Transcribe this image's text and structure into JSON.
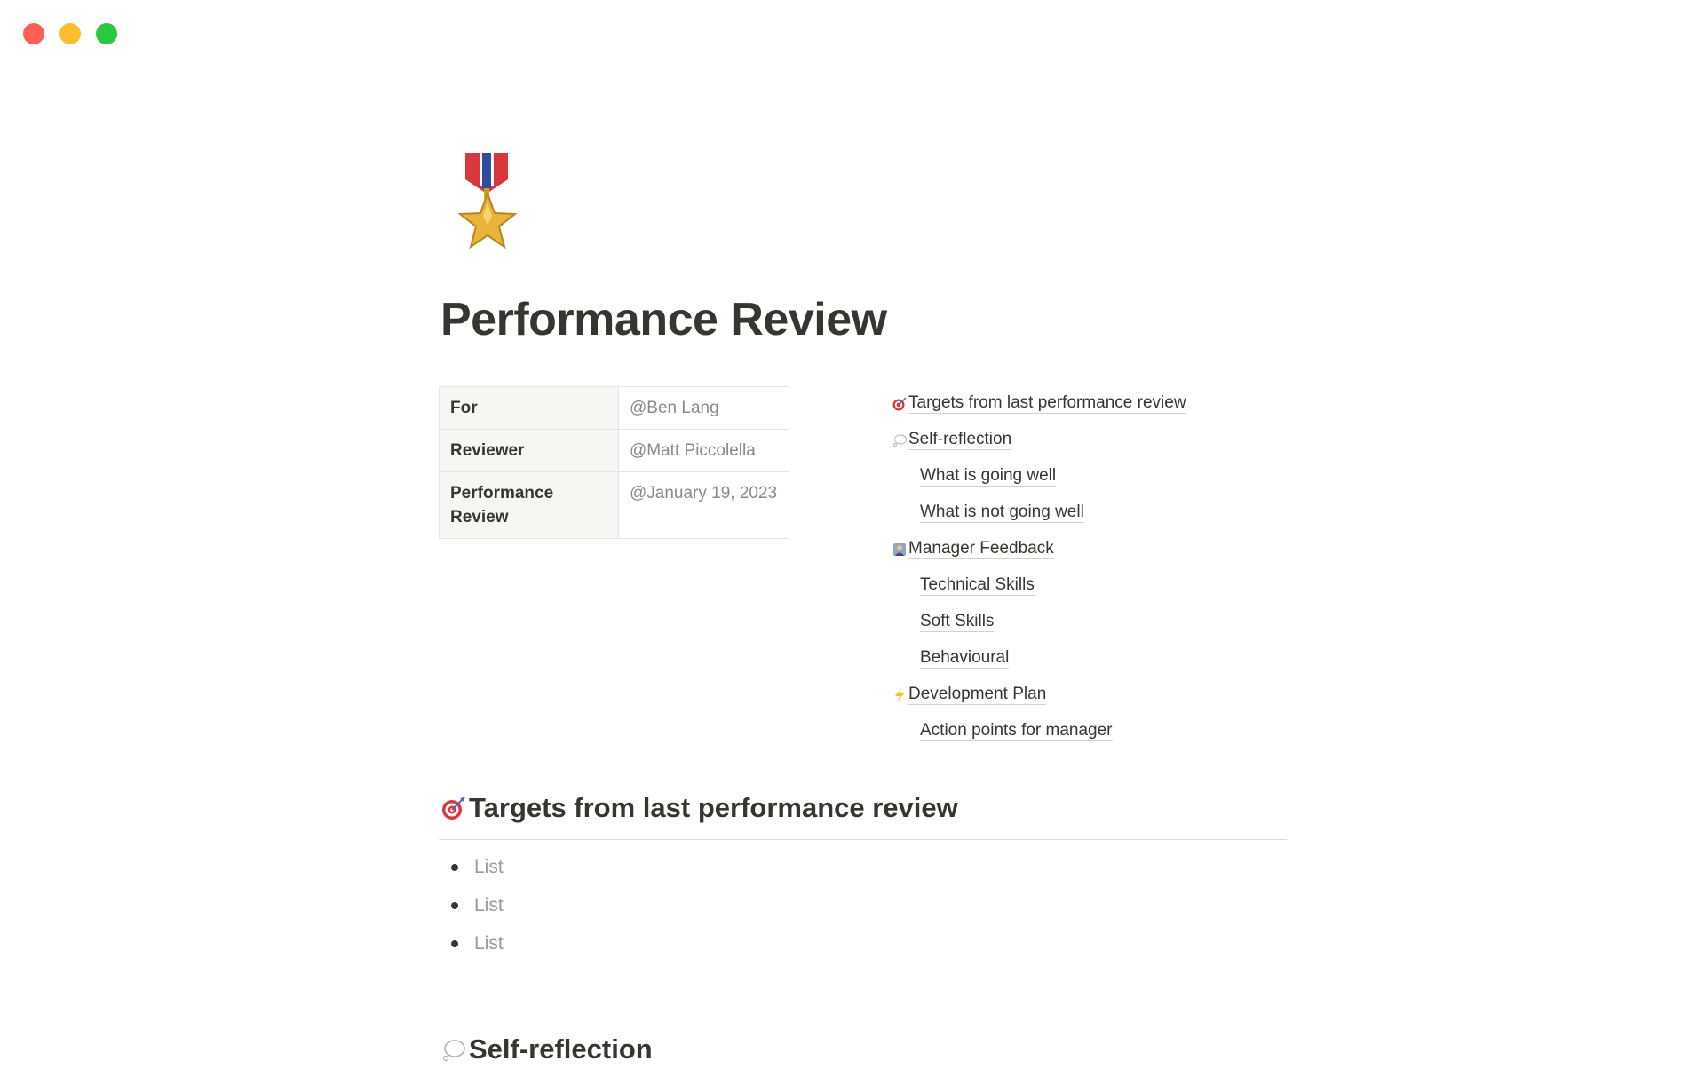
{
  "window": {
    "controls": [
      "close",
      "minimize",
      "zoom"
    ]
  },
  "page": {
    "icon": "military-medal-icon",
    "title": "Performance Review"
  },
  "properties": [
    {
      "key": "For",
      "value": "@Ben Lang"
    },
    {
      "key": "Reviewer",
      "value": "@Matt Piccolella"
    },
    {
      "key": "Performance Review",
      "value": "@January 19, 2023"
    }
  ],
  "toc": [
    {
      "label": "Targets from last performance review",
      "icon": "target-icon",
      "level": 1
    },
    {
      "label": "Self-reflection",
      "icon": "thought-bubble-icon",
      "level": 1
    },
    {
      "label": "What is going well",
      "level": 2
    },
    {
      "label": "What is not going well",
      "level": 2
    },
    {
      "label": "Manager Feedback",
      "icon": "manager-icon",
      "level": 1
    },
    {
      "label": "Technical Skills",
      "level": 2
    },
    {
      "label": "Soft Skills",
      "level": 2
    },
    {
      "label": "Behavioural",
      "level": 2
    },
    {
      "label": "Development Plan",
      "icon": "lightning-icon",
      "level": 1
    },
    {
      "label": "Action points for manager",
      "level": 2
    }
  ],
  "sections": [
    {
      "heading": "Targets from last performance review",
      "icon": "target-icon",
      "bullets": [
        "List",
        "List",
        "List"
      ]
    },
    {
      "heading": "Self-reflection",
      "icon": "thought-bubble-icon"
    }
  ],
  "colors": {
    "close": "#fe5f57",
    "minimize": "#febc2e",
    "zoom": "#28c840",
    "text": "#37352f",
    "muted": "#9b9a97"
  }
}
